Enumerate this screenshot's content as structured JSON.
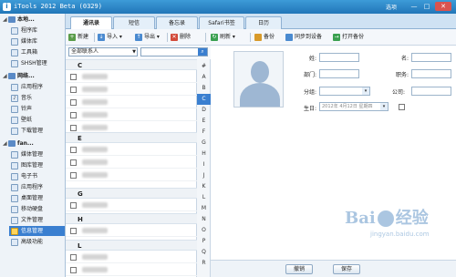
{
  "window": {
    "title": "iTools 2012 Beta (0329)",
    "options_label": "选项",
    "minimize": "—",
    "maximize": "□",
    "close": "✕"
  },
  "sidebar": {
    "groups": [
      {
        "label": "本地...",
        "items": [
          "程序库",
          "媒体库",
          "工具箱",
          "SHSH管理"
        ]
      },
      {
        "label": "网络...",
        "items": [
          "应用程序",
          "音乐",
          "铃声",
          "壁纸",
          "下载管理"
        ]
      },
      {
        "label": "fan...",
        "items": [
          "媒体管理",
          "图库管理",
          "电子书",
          "应用程序",
          "桌面管理",
          "移动硬盘",
          "文件管理",
          "信息管理",
          "高级功能"
        ]
      }
    ],
    "active_item": "信息管理"
  },
  "tabs": [
    "通讯录",
    "短信",
    "备忘录",
    "Safari书签",
    "日历"
  ],
  "active_tab": "通讯录",
  "toolbar": {
    "new": "新建",
    "import": "导入",
    "export": "导出",
    "delete": "删除",
    "refresh": "刷新",
    "backup": "备份",
    "sync": "同步到设备",
    "open_backup": "打开备份"
  },
  "filter": {
    "group_select": "全部联系人",
    "search_placeholder": ""
  },
  "contacts": {
    "letters_shown": [
      "C",
      "E",
      "G",
      "H",
      "L"
    ]
  },
  "alphabet": [
    "#",
    "A",
    "B",
    "C",
    "D",
    "E",
    "F",
    "G",
    "H",
    "I",
    "J",
    "K",
    "L",
    "M",
    "N",
    "O",
    "P",
    "Q",
    "R"
  ],
  "active_letter": "C",
  "detail": {
    "surname_label": "姓:",
    "name_label": "名:",
    "dept_label": "部门:",
    "title_label": "职务:",
    "group_label": "分组:",
    "company_label": "公司:",
    "birthday_label": "生日:",
    "birthday_value": "2012年 4月12日 星期四"
  },
  "bottom": {
    "undo": "撤销",
    "save": "保存"
  },
  "watermark": {
    "logo_left": "Bai",
    "logo_right": "经验",
    "url": "jingyan.baidu.com"
  },
  "colors": {
    "accent": "#3a7fd0",
    "titlebar": "#2176b8"
  }
}
